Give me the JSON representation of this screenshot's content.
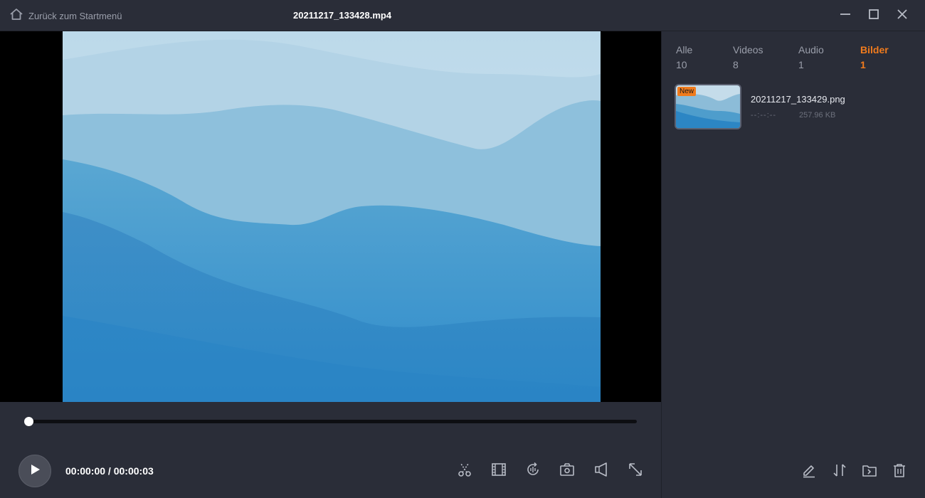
{
  "header": {
    "back_label": "Zurück zum Startmenü",
    "file_title": "20211217_133428.mp4"
  },
  "player": {
    "current_time": "00:00:00",
    "separator": " / ",
    "total_time": "00:00:03",
    "progress": 0.0
  },
  "tabs": [
    {
      "label": "Alle",
      "count": "10",
      "active": false
    },
    {
      "label": "Videos",
      "count": "8",
      "active": false
    },
    {
      "label": "Audio",
      "count": "1",
      "active": false
    },
    {
      "label": "Bilder",
      "count": "1",
      "active": true
    }
  ],
  "media_items": [
    {
      "badge": "New",
      "name": "20211217_133429.png",
      "duration": "--:--:--",
      "size": "257.96 KB"
    }
  ],
  "icons": {
    "back": "home-icon",
    "window": [
      "minimize-icon",
      "maximize-icon",
      "close-icon"
    ],
    "controls": [
      "cut-icon",
      "film-strip-icon",
      "rotate-icon",
      "screenshot-camera-icon",
      "volume-speaker-icon",
      "fullscreen-expand-icon"
    ],
    "sidebar": [
      "edit-pencil-icon",
      "sort-arrows-icon",
      "open-folder-icon",
      "trash-icon"
    ]
  },
  "colors": {
    "accent": "#f07b1d",
    "background": "#2a2d38",
    "text_muted": "#9a9eaa"
  }
}
